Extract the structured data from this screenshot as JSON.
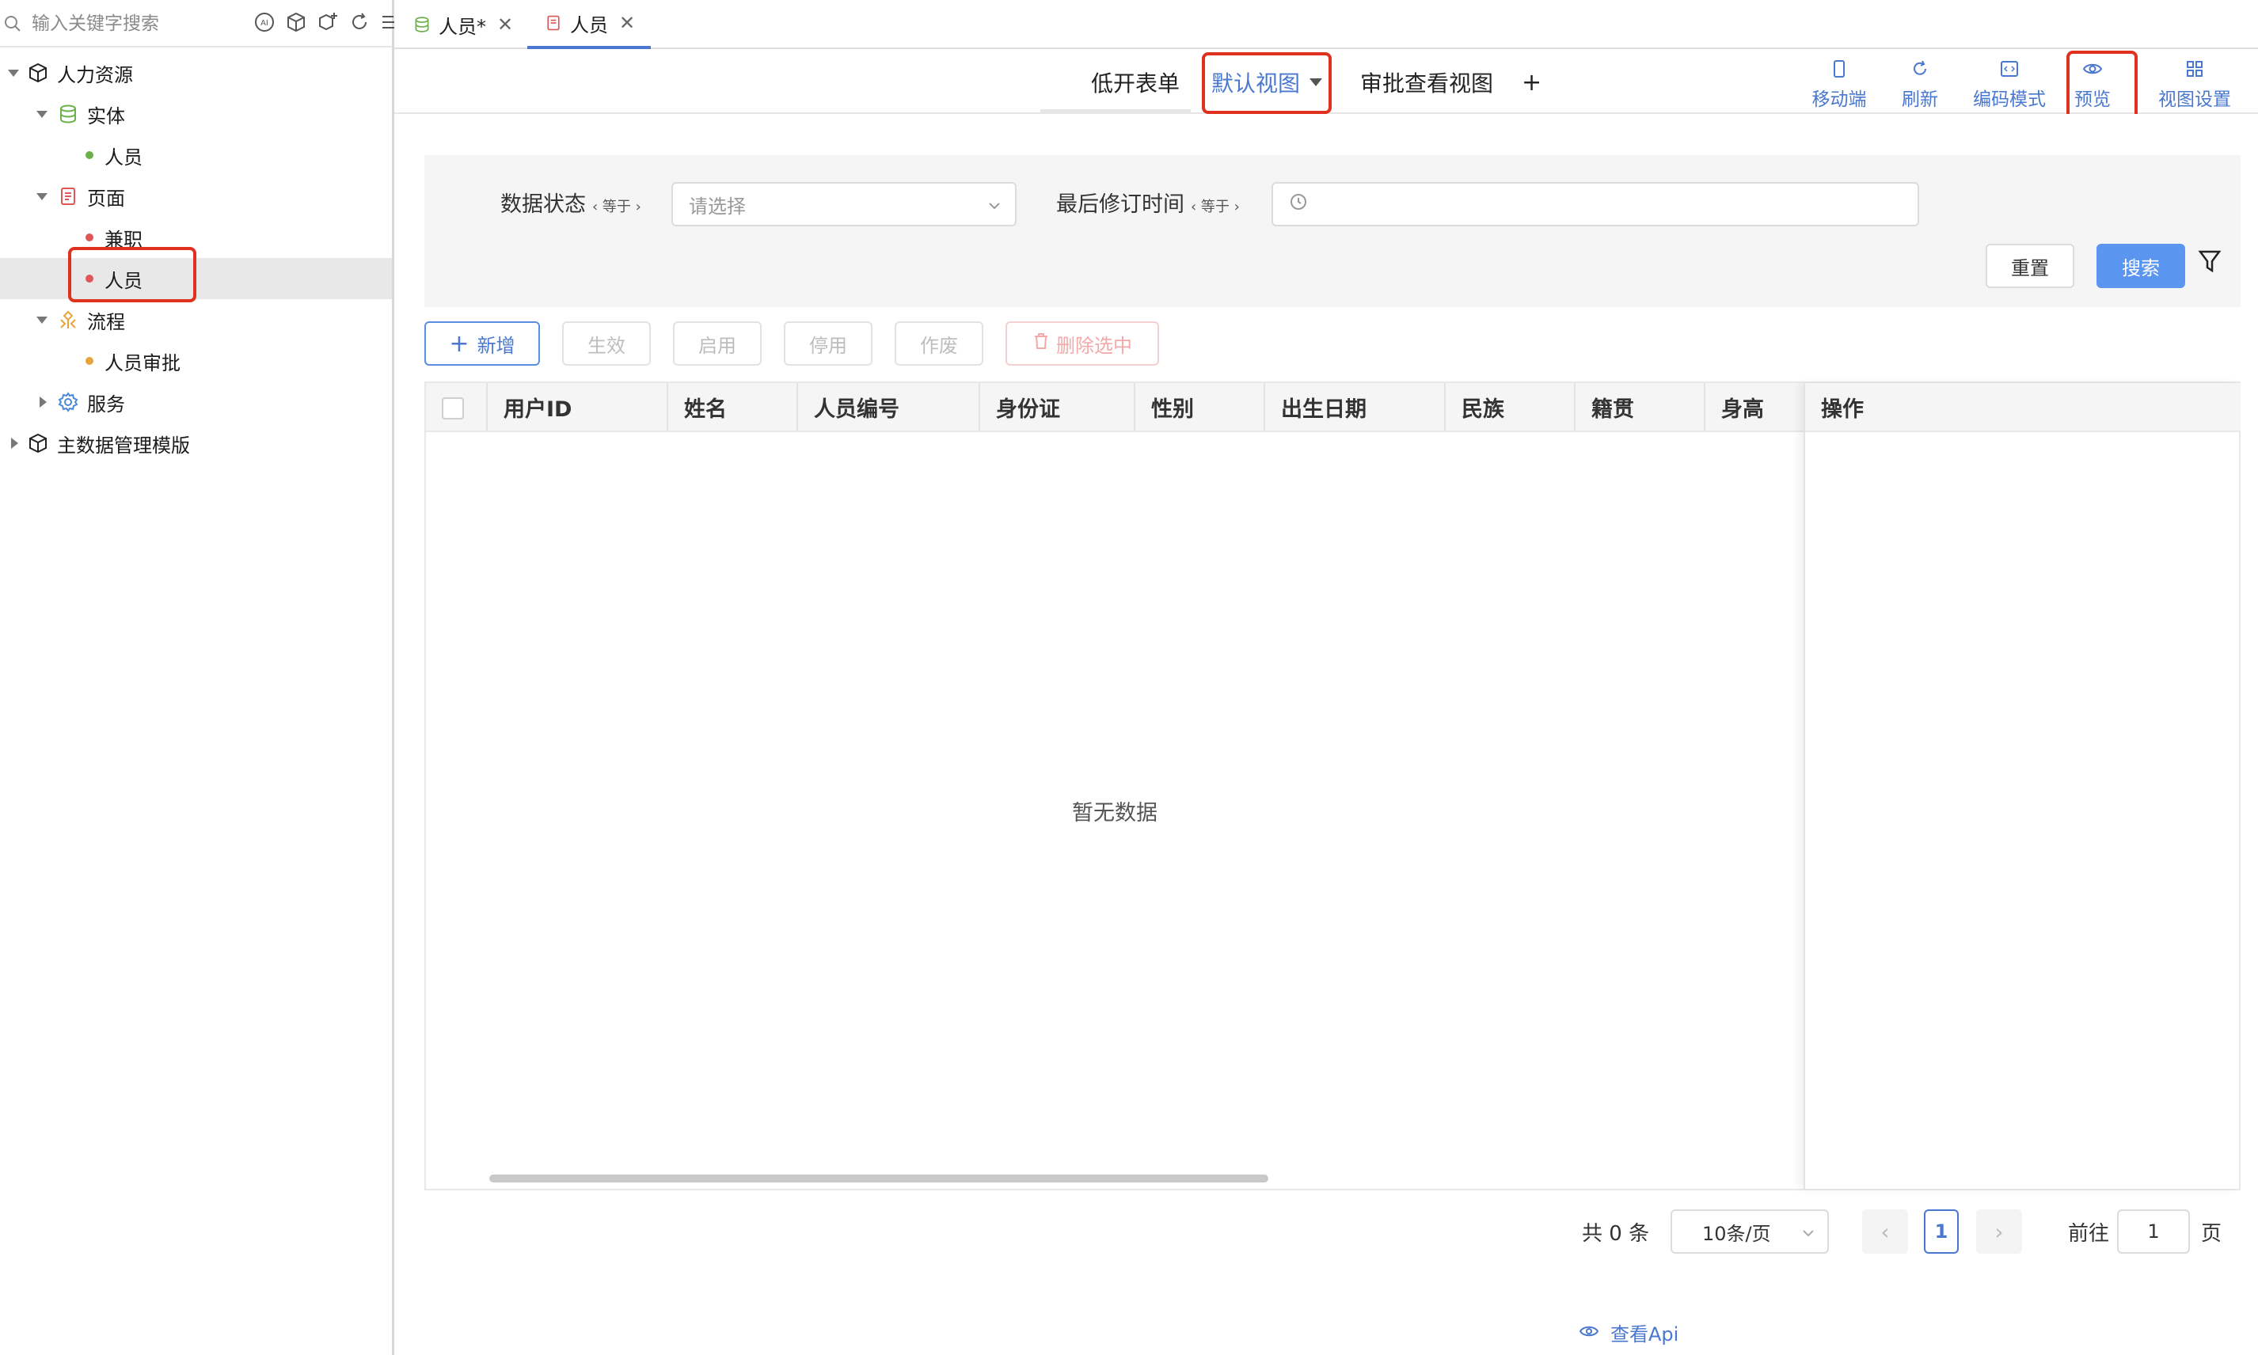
{
  "sidebar": {
    "search_placeholder": "输入关键字搜索",
    "tree": [
      {
        "label": "人力资源"
      },
      {
        "label": "实体"
      },
      {
        "label": "人员"
      },
      {
        "label": "页面"
      },
      {
        "label": "兼职"
      },
      {
        "label": "人员"
      },
      {
        "label": "流程"
      },
      {
        "label": "人员审批"
      },
      {
        "label": "服务"
      },
      {
        "label": "主数据管理模版"
      }
    ]
  },
  "doc_tabs": [
    {
      "label": "人员*"
    },
    {
      "label": "人员"
    }
  ],
  "view_tabs": {
    "items": [
      "低开表单",
      "默认视图",
      "审批查看视图"
    ],
    "add": "+"
  },
  "toolbar": {
    "mobile": "移动端",
    "refresh": "刷新",
    "code_mode": "编码模式",
    "preview": "预览",
    "view_settings": "视图设置"
  },
  "filter": {
    "status_label": "数据状态",
    "status_op": "‹ 等于 ›",
    "status_placeholder": "请选择",
    "time_label": "最后修订时间",
    "time_op": "‹ 等于 ›",
    "reset": "重置",
    "search": "搜索"
  },
  "actions": {
    "add": "新增",
    "effective": "生效",
    "enable": "启用",
    "disable": "停用",
    "void": "作废",
    "delete_selected": "删除选中"
  },
  "table": {
    "columns": [
      "用户ID",
      "姓名",
      "人员编号",
      "身份证",
      "性别",
      "出生日期",
      "民族",
      "籍贯",
      "身高"
    ],
    "op_column": "操作",
    "empty": "暂无数据"
  },
  "pagination": {
    "total": "共 0 条",
    "page_size": "10条/页",
    "prev": "‹",
    "current": "1",
    "next": "›",
    "goto_label": "前往",
    "goto_value": "1",
    "page_suffix": "页"
  },
  "api_link": "查看Api",
  "colors": {
    "accent": "#4a78d0",
    "primary_button": "#5a95f0",
    "highlight_box": "#e0301e"
  }
}
